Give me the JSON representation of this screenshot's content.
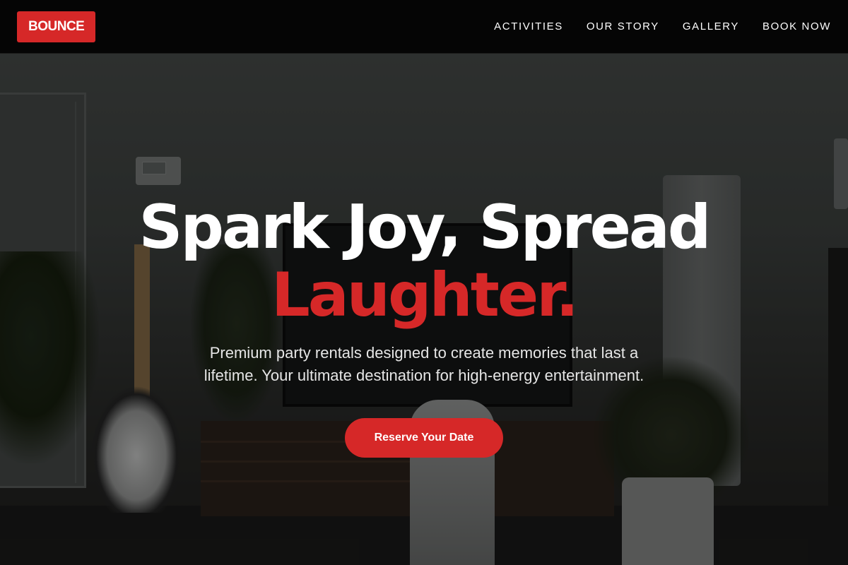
{
  "header": {
    "logo": "BOUNCE",
    "nav": [
      {
        "label": "ACTIVITIES"
      },
      {
        "label": "OUR STORY"
      },
      {
        "label": "GALLERY"
      },
      {
        "label": "BOOK NOW"
      }
    ]
  },
  "hero": {
    "headline_line1": "Spark Joy, Spread",
    "headline_accent": "Laughter.",
    "subtitle": "Premium party rentals designed to create memories that last a lifetime. Your ultimate destination for high-energy entertainment.",
    "cta_label": "Reserve Your Date"
  },
  "colors": {
    "accent": "#d62828",
    "nav_background": "#050505",
    "text": "#ffffff"
  }
}
